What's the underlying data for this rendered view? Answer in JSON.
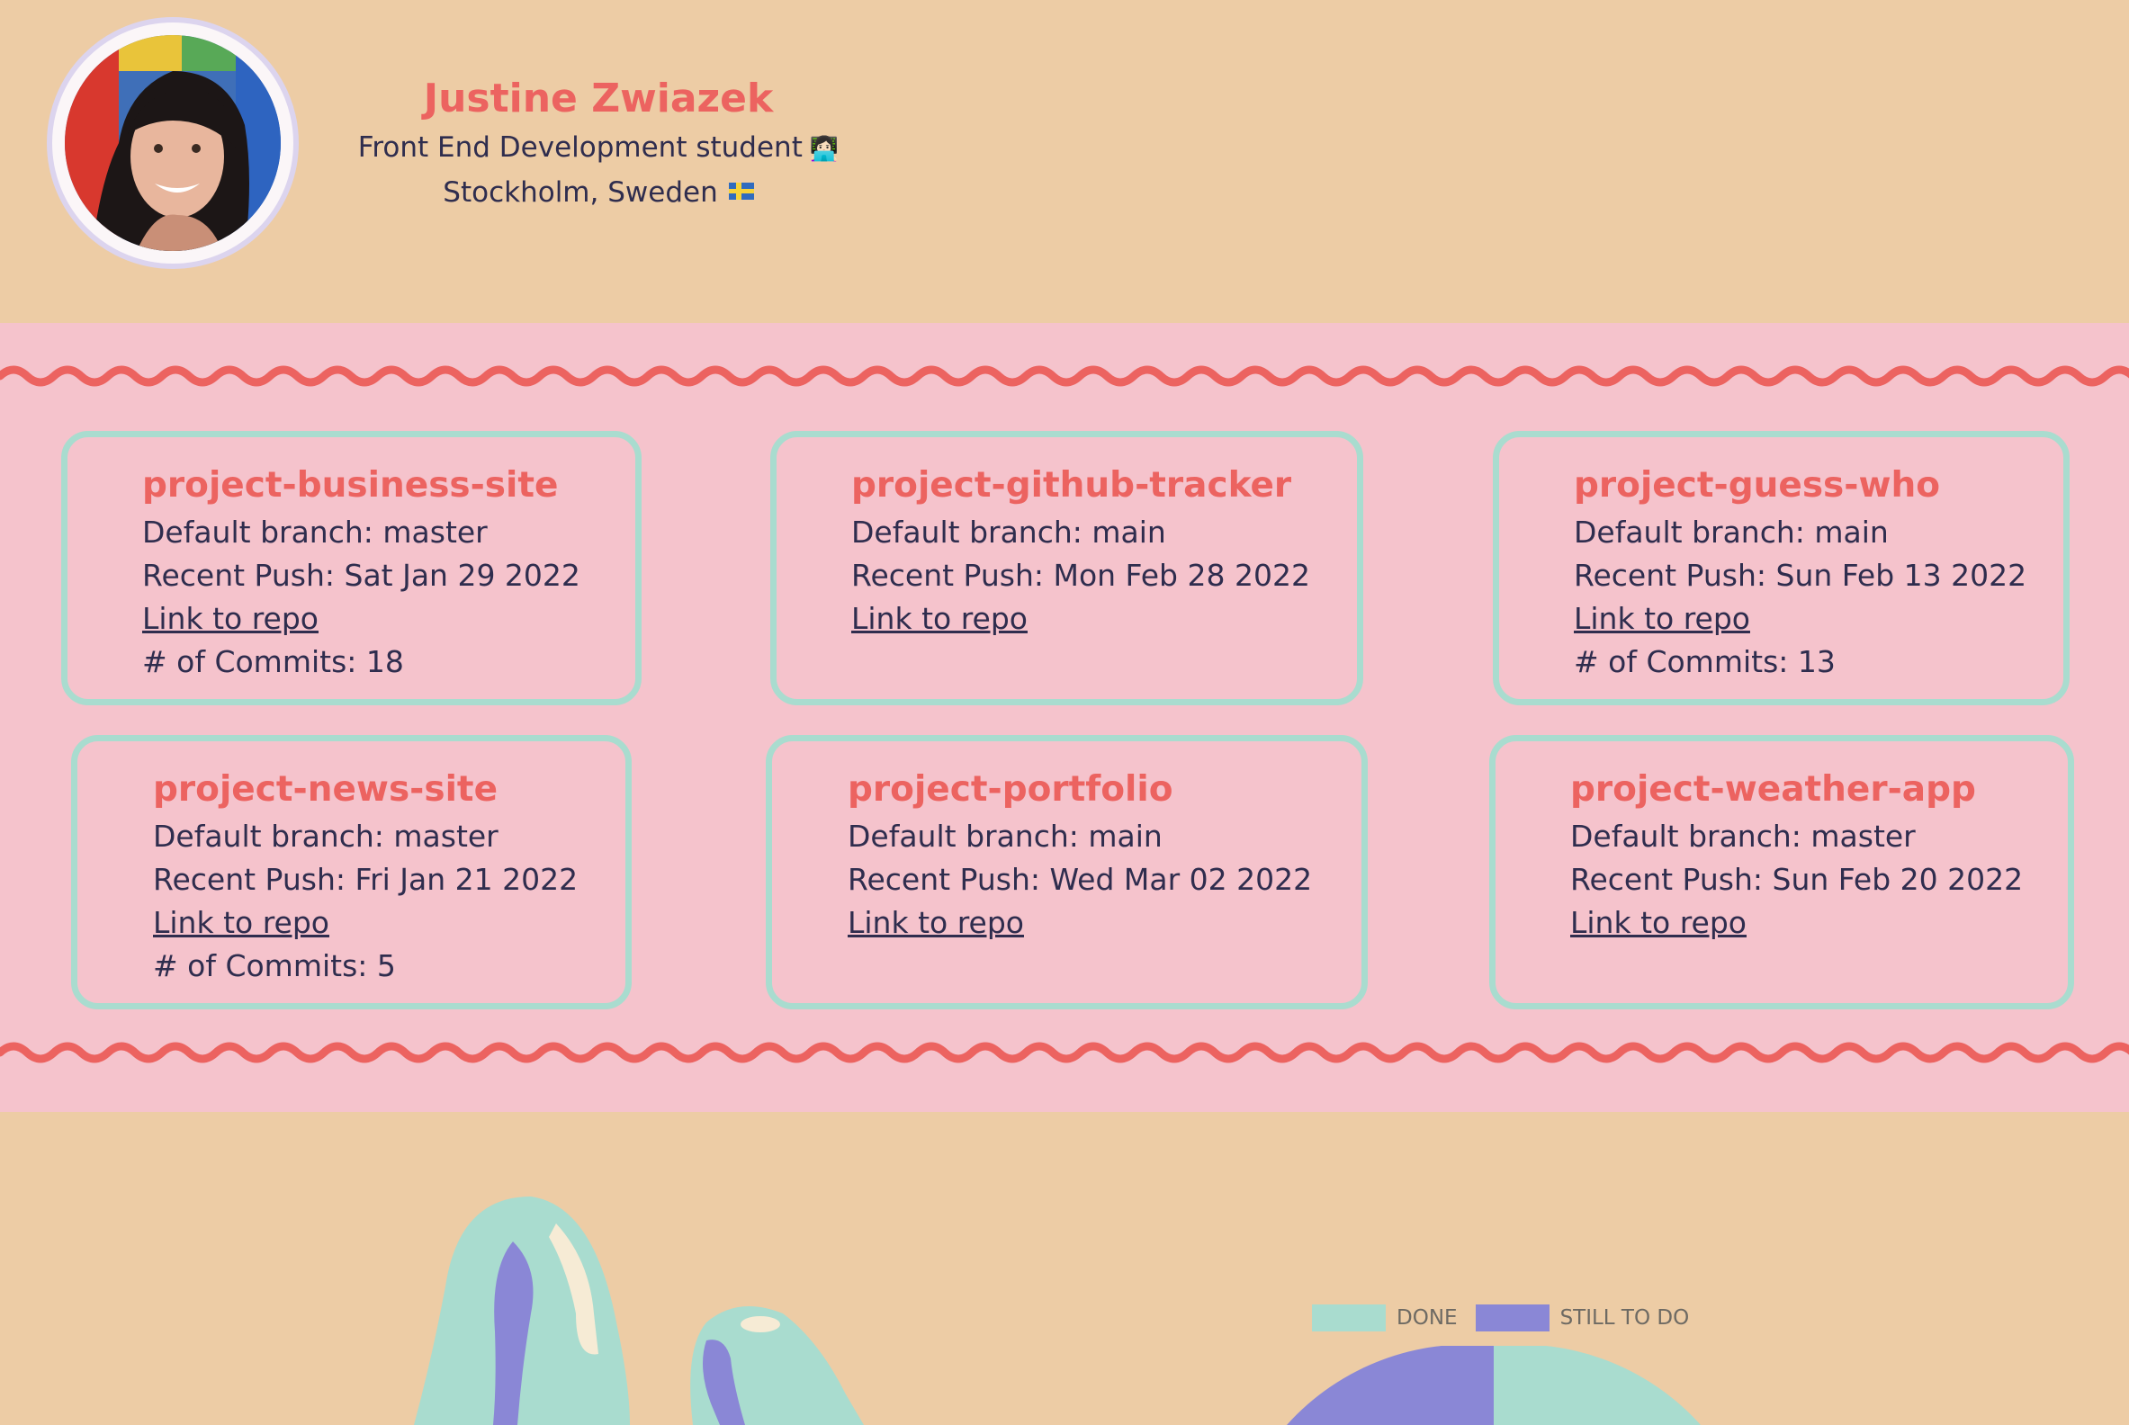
{
  "profile": {
    "name": "Justine Zwiazek",
    "role": "Front End Development student",
    "location": "Stockholm, Sweden"
  },
  "projects": [
    {
      "name": "project-business-site",
      "branch": "Default branch: master",
      "push": "Recent Push: Sat Jan 29 2022",
      "link": "Link to repo",
      "commits": "# of Commits: 18"
    },
    {
      "name": "project-github-tracker",
      "branch": "Default branch: main",
      "push": "Recent Push: Mon Feb 28 2022",
      "link": "Link to repo",
      "commits": ""
    },
    {
      "name": "project-guess-who",
      "branch": "Default branch: main",
      "push": "Recent Push: Sun Feb 13 2022",
      "link": "Link to repo",
      "commits": "# of Commits: 13"
    },
    {
      "name": "project-news-site",
      "branch": "Default branch: master",
      "push": "Recent Push: Fri Jan 21 2022",
      "link": "Link to repo",
      "commits": "# of Commits: 5"
    },
    {
      "name": "project-portfolio",
      "branch": "Default branch: main",
      "push": "Recent Push: Wed Mar 02 2022",
      "link": "Link to repo",
      "commits": ""
    },
    {
      "name": "project-weather-app",
      "branch": "Default branch: master",
      "push": "Recent Push: Sun Feb 20 2022",
      "link": "Link to repo",
      "commits": ""
    }
  ],
  "progress_chart": {
    "legend": [
      {
        "label": "DONE",
        "color": "#a9dccf"
      },
      {
        "label": "STILL TO DO",
        "color": "#8a87d6"
      }
    ]
  },
  "colors": {
    "background": "#edcca5",
    "band": "#f5c3cc",
    "accent": "#ec6360",
    "card_border": "#a9dccf",
    "text": "#2f2d4e"
  }
}
